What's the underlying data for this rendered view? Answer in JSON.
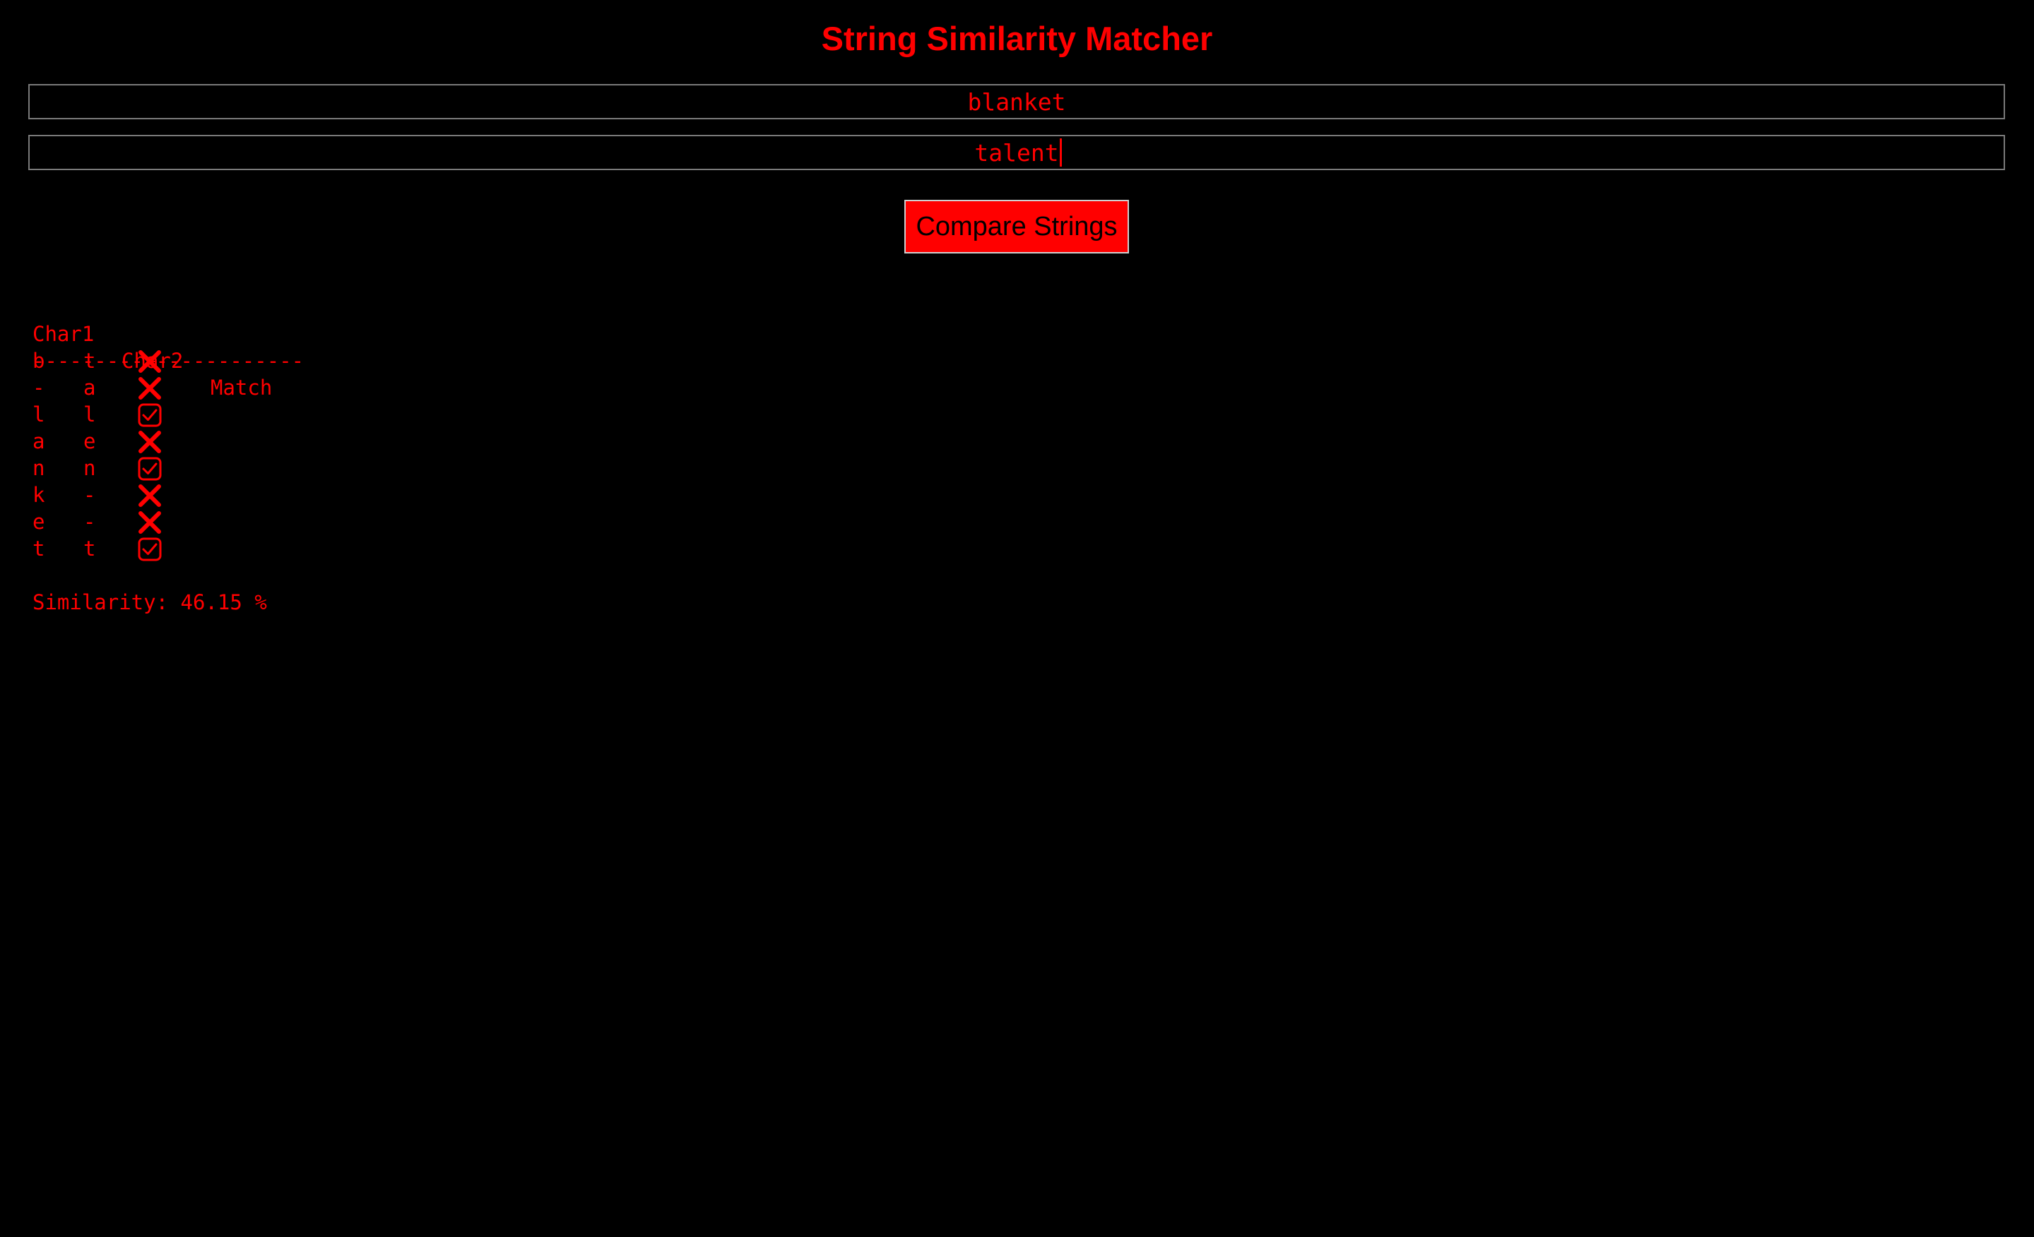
{
  "app": {
    "title": "String Similarity Matcher"
  },
  "inputs": {
    "string1": "blanket",
    "string2": "talent"
  },
  "button": {
    "label": "Compare Strings"
  },
  "results": {
    "headers": [
      "Char1",
      "Char2",
      "Match"
    ],
    "divider": "----------------------",
    "rows": [
      {
        "char1": "b",
        "char2": "t",
        "match": false,
        "icon": "cross-mark-icon"
      },
      {
        "char1": "-",
        "char2": "a",
        "match": false,
        "icon": "cross-mark-icon"
      },
      {
        "char1": "l",
        "char2": "l",
        "match": true,
        "icon": "check-box-icon"
      },
      {
        "char1": "a",
        "char2": "e",
        "match": false,
        "icon": "cross-mark-icon"
      },
      {
        "char1": "n",
        "char2": "n",
        "match": true,
        "icon": "check-box-icon"
      },
      {
        "char1": "k",
        "char2": "-",
        "match": false,
        "icon": "cross-mark-icon"
      },
      {
        "char1": "e",
        "char2": "-",
        "match": false,
        "icon": "cross-mark-icon"
      },
      {
        "char1": "t",
        "char2": "t",
        "match": true,
        "icon": "check-box-icon"
      }
    ],
    "similarity_label": "Similarity:",
    "similarity_value": "46.15",
    "similarity_unit": "%"
  },
  "colors": {
    "background": "#000000",
    "accent": "#ff0000",
    "input_border": "#7a7a7a",
    "button_text": "#000000"
  }
}
